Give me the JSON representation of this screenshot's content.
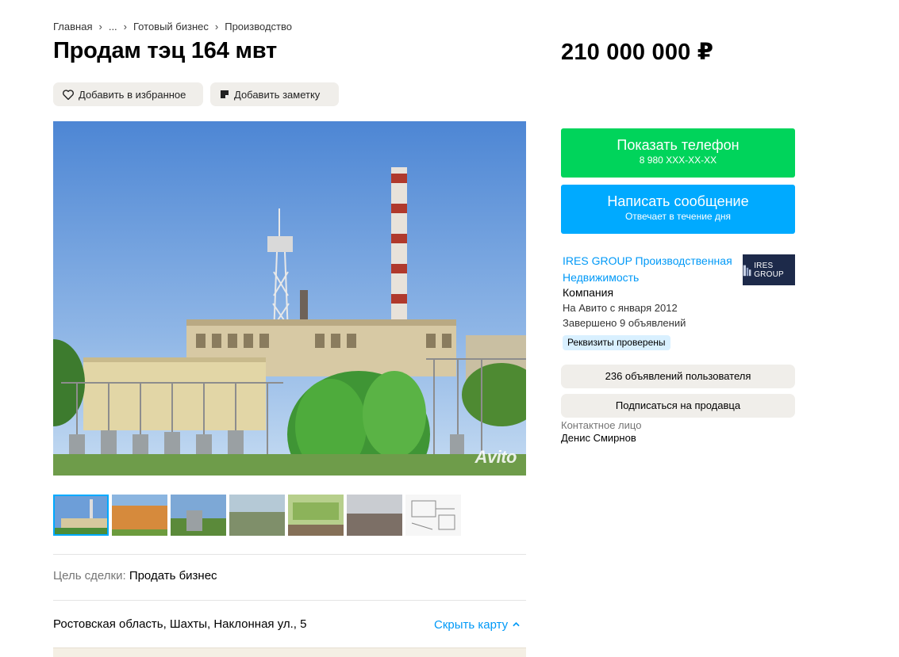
{
  "breadcrumb": {
    "items": [
      "Главная",
      "...",
      "Готовый бизнес",
      "Производство"
    ]
  },
  "listing": {
    "title": "Продам тэц 164 мвт",
    "price": "210 000 000 ₽"
  },
  "actions": {
    "favorite_label": "Добавить в избранное",
    "note_label": "Добавить заметку"
  },
  "gallery": {
    "watermark": "Avito",
    "thumbnail_count": 7
  },
  "details": {
    "deal_label": "Цель сделки:",
    "deal_value": "Продать бизнес",
    "address": "Ростовская область, Шахты, Наклонная ул., 5",
    "hide_map_label": "Скрыть карту"
  },
  "contact_buttons": {
    "phone_label": "Показать телефон",
    "phone_number": "8 980 XXX-XX-XX",
    "message_label": "Написать сообщение",
    "message_sub": "Отвечает в течение дня"
  },
  "seller": {
    "name": "IRES GROUP Производственная Недвижимость",
    "logo_text": "IRES GROUP",
    "type": "Компания",
    "since": "На Авито с января 2012",
    "completed": "Завершено 9 объявлений",
    "verified_badge": "Реквизиты проверены",
    "ads_button": "236 объявлений пользователя",
    "subscribe_button": "Подписаться на продавца",
    "contact_label": "Контактное лицо",
    "contact_name": "Денис Смирнов"
  },
  "colors": {
    "phone_button": "#00d45b",
    "message_button": "#00aaff",
    "link": "#0099f7",
    "verified_badge_bg": "#d9f0ff"
  }
}
